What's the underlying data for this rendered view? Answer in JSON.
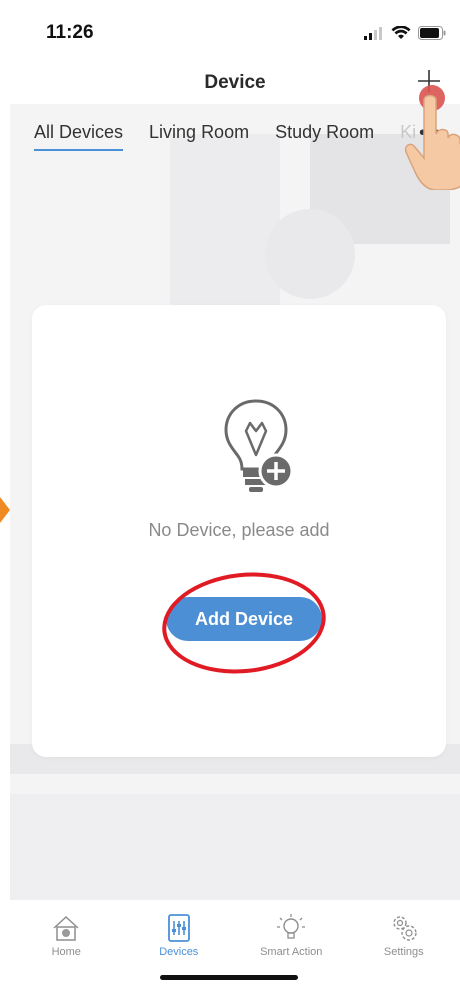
{
  "status_bar": {
    "time": "11:26"
  },
  "header": {
    "title": "Device"
  },
  "tabs": [
    {
      "label": "All Devices",
      "active": true
    },
    {
      "label": "Living Room",
      "active": false
    },
    {
      "label": "Study Room",
      "active": false
    },
    {
      "label": "Ki",
      "active": false
    }
  ],
  "empty_state": {
    "message": "No Device, please add",
    "add_button_label": "Add Device"
  },
  "tab_bar": {
    "items": [
      {
        "label": "Home",
        "icon": "home-icon",
        "active": false
      },
      {
        "label": "Devices",
        "icon": "devices-icon",
        "active": true
      },
      {
        "label": "Smart Action",
        "icon": "smart-action-icon",
        "active": false
      },
      {
        "label": "Settings",
        "icon": "settings-icon",
        "active": false
      }
    ]
  },
  "colors": {
    "accent": "#4a90d9",
    "button": "#4d8fd4",
    "annotation_red": "#e01b24",
    "annotation_orange": "#f08a24"
  }
}
